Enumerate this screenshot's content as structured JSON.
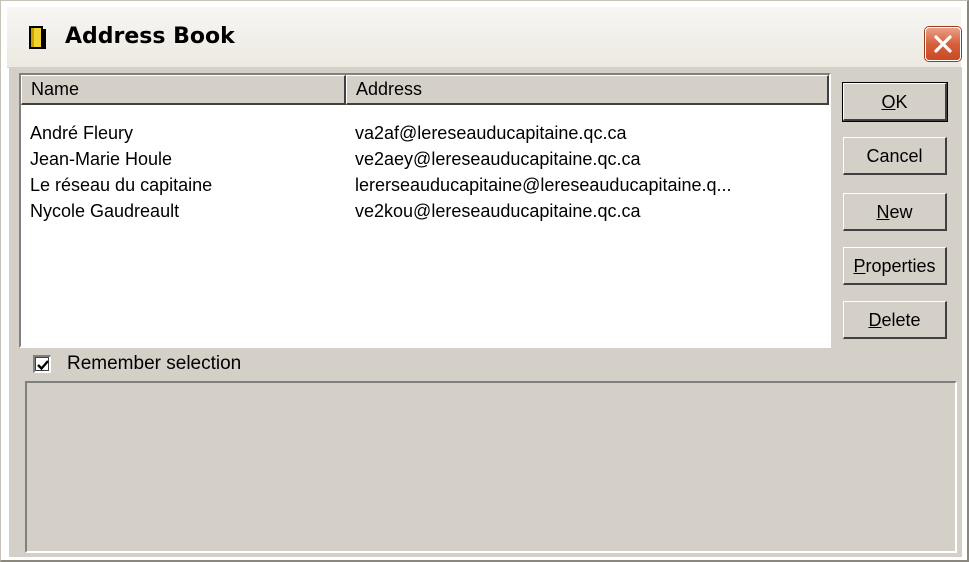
{
  "window": {
    "title": "Address Book",
    "title_icon": "address-book-icon",
    "close_icon": "close-icon"
  },
  "list": {
    "columns": [
      "Name",
      "Address"
    ],
    "rows": [
      {
        "name": "André Fleury",
        "address": "va2af@lereseauducapitaine.qc.ca"
      },
      {
        "name": "Jean-Marie Houle",
        "address": "ve2aey@lereseauducapitaine.qc.ca"
      },
      {
        "name": "Le réseau du capitaine",
        "address": "lererseauducapitaine@lereseauducapitaine.q..."
      },
      {
        "name": "Nycole Gaudreault",
        "address": "ve2kou@lereseauducapitaine.qc.ca"
      }
    ]
  },
  "buttons": {
    "ok": {
      "accel": "O",
      "rest": "K"
    },
    "cancel": "Cancel",
    "new": {
      "accel": "N",
      "rest": "ew"
    },
    "properties": {
      "accel": "P",
      "rest": "roperties"
    },
    "delete": {
      "accel": "D",
      "rest": "elete"
    }
  },
  "remember": {
    "label": "Remember selection",
    "checked": true
  },
  "colors": {
    "face": "#d4d0c8",
    "close_button": "#d6603b"
  }
}
